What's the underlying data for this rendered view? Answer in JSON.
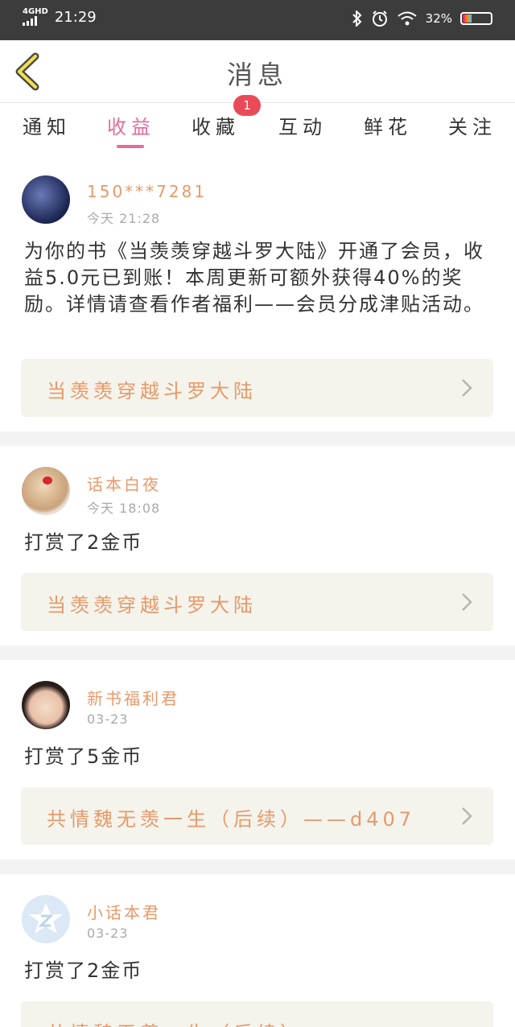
{
  "status_bar": {
    "network": "4GHD",
    "time": "21:29",
    "battery": "32%"
  },
  "header": {
    "title": "消息"
  },
  "tabs": [
    {
      "label": "通知"
    },
    {
      "label": "收益"
    },
    {
      "label": "收藏"
    },
    {
      "label": "互动"
    },
    {
      "label": "鲜花"
    },
    {
      "label": "关注"
    }
  ],
  "active_tab": "收益",
  "tab_badge": {
    "tab": "收藏",
    "count": "1"
  },
  "feed": [
    {
      "username": "150***7281",
      "time": "今天 21:28",
      "message": "为你的书《当羡羡穿越斗罗大陆》开通了会员，收益5.0元已到账！本周更新可额外获得40%的奖励。详情请查看作者福利——会员分成津贴活动。",
      "book": "当羡羡穿越斗罗大陆",
      "avatar": "dark-blue-avatar-icon"
    },
    {
      "username": "话本白夜",
      "time": "今天 18:08",
      "message": "打赏了2金币",
      "book": "当羡羡穿越斗罗大陆",
      "avatar": "girl-red-bow-avatar-icon"
    },
    {
      "username": "新书福利君",
      "time": "03-23",
      "message": "打赏了5金币",
      "book": "共情魏无羡一生（后续）——d407",
      "avatar": "girl-portrait-avatar-icon"
    },
    {
      "username": "小话本君",
      "time": "03-23",
      "message": "打赏了2金币",
      "book": "共情魏无羡一生（后续）",
      "avatar": "z-logo-avatar-icon"
    }
  ],
  "colors": {
    "accent": "#e26c9a",
    "name": "#e8996a",
    "badge": "#e94a57",
    "box_bg": "#f4f4ec"
  }
}
